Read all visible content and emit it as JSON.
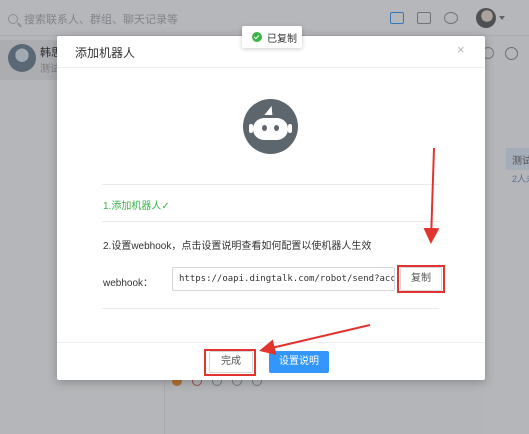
{
  "app": {
    "search_placeholder": "搜索联系人、群组、聊天记录等",
    "conversation": {
      "name": "韩思",
      "preview": "测试"
    },
    "right_card": "测试",
    "right_count": "2人未"
  },
  "toast": {
    "text": "已复制"
  },
  "dialog": {
    "title": "添加机器人",
    "close": "×",
    "step1": "1.添加机器人✓",
    "step2": "2.设置webhook，点击设置说明查看如何配置以使机器人生效",
    "webhook_label": "webhook：",
    "webhook_value": "https://oapi.dingtalk.com/robot/send?access_token=",
    "copy_label": "复制",
    "done_label": "完成",
    "setup_label": "设置说明"
  },
  "colors": {
    "success_green": "#3bb54a",
    "primary_blue": "#3296fa",
    "annotation_red": "#e2342f"
  }
}
